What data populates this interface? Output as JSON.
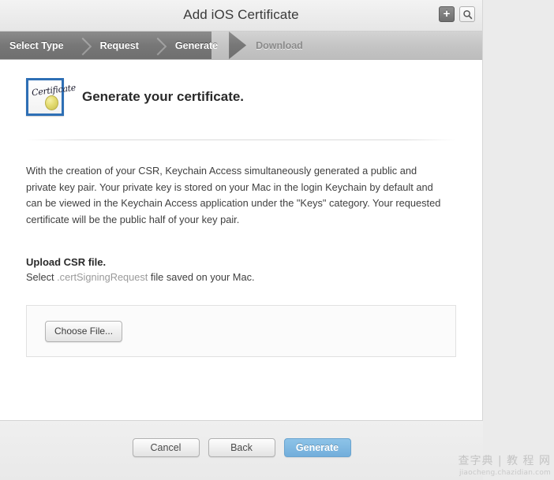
{
  "window": {
    "title": "Add iOS Certificate"
  },
  "titlebar_actions": [
    {
      "name": "add-button",
      "icon": "plus-icon",
      "label": "+"
    },
    {
      "name": "search-button",
      "icon": "search-icon",
      "label": ""
    }
  ],
  "steps": [
    {
      "label": "Select Type",
      "state": "active"
    },
    {
      "label": "Request",
      "state": "active"
    },
    {
      "label": "Generate",
      "state": "active"
    },
    {
      "label": "Download",
      "state": "inactive"
    }
  ],
  "hero": {
    "icon_word": "Certificate",
    "heading": "Generate your certificate."
  },
  "body": {
    "paragraph": "With the creation of your CSR, Keychain Access simultaneously generated a public and private key pair. Your private key is stored on your Mac in the login Keychain by default and can be viewed in the Keychain Access application under the \"Keys\" category. Your requested certificate will be the public half of your key pair."
  },
  "upload": {
    "title": "Upload CSR file.",
    "sub_prefix": "Select ",
    "sub_highlight": ".certSigningRequest",
    "sub_suffix": " file saved on your Mac.",
    "choose_file_label": "Choose File..."
  },
  "footer": {
    "cancel_label": "Cancel",
    "back_label": "Back",
    "generate_label": "Generate"
  },
  "watermark": {
    "logo": "查字典 | 教 程 网",
    "url": "jiaocheng.chazidian.com"
  },
  "colors": {
    "primary_button": "#72aedb",
    "step_active_bg": "#777777",
    "step_inactive_bg": "#c4c4c4",
    "cert_icon_border": "#2e6fb5",
    "seal_gold": "#e3db70"
  }
}
